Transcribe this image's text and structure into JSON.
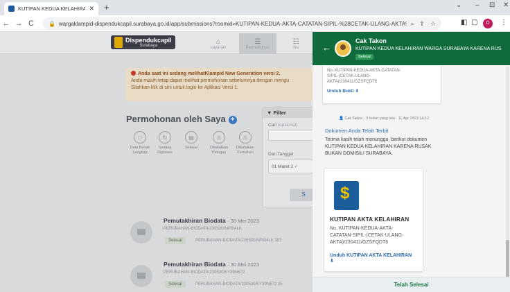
{
  "browser": {
    "tab_title": "KUTIPAN KEDUA KELAHIRAN WA",
    "new_tab": "+",
    "url": "wargaklampid-dispendukcapil.surabaya.go.id/app/submissions?roomid=KUTIPAN-KEDUA-AKTA-CATATAN-SIPIL-%28CETAK-ULANG-AKTA%29%2F230411%2FGZSF...",
    "profile_letter": "D",
    "minimize": "⌄",
    "restore": "–",
    "ext": "⊡",
    "close": "✕"
  },
  "app": {
    "logo_title": "Dispendukcapil",
    "logo_sub": "Surabaya",
    "menu": [
      {
        "label": "Layanan",
        "icon": "⌂"
      },
      {
        "label": "Permohonan",
        "icon": "☰"
      },
      {
        "label": "No",
        "icon": "☷"
      }
    ],
    "alert_line1": "Anda saat ini sedang melihatKlampid New Generation versi 2.",
    "alert_line2": "Anda masih tetap dapat melihat permohonan sebelumnya dengan mengu",
    "alert_line3": "Silahkan klik di sini untuk login ke Aplikasi Versi 1.",
    "section_title": "Permohonan oleh Saya",
    "statuses": [
      {
        "l1": "Data Belum",
        "l2": "Lengkap",
        "icon": "□"
      },
      {
        "l1": "Sedang",
        "l2": "Diproses",
        "icon": "↻"
      },
      {
        "l1": "Selesai",
        "l2": "",
        "icon": "▤"
      },
      {
        "l1": "Dibatalkan",
        "l2": "Petugas",
        "icon": "⚠"
      },
      {
        "l1": "Dibatalkan",
        "l2": "Pemohon",
        "icon": "⚠"
      }
    ],
    "filter_title": "Filter",
    "filter_cari_label": "Cari",
    "filter_cari_hint": "(opsional)",
    "filter_date_label": "Dari Tanggal",
    "filter_date_value": "01 Maret 2",
    "filter_btn": "S",
    "submissions": [
      {
        "title": "Pemutakhiran Biodata",
        "date": "· 30 Mei 2023",
        "code": "PERUBAHAN-BIODATA/230530/MP8I4LK",
        "badge": "Selesai",
        "code2": "PERUBAHAN-BIODATA/230530/MP8I4LK 357"
      },
      {
        "title": "Pemutakhiran Biodata",
        "date": "· 30 Mei 2023",
        "code": "PERUBAHAN-BIODATA/230530/KY39N672",
        "badge": "Selesai",
        "code2": "PERUBAHAN-BIODATA/230530/KY39N672 35"
      }
    ]
  },
  "panel": {
    "name": "Cak Takon",
    "subject": "KUTIPAN KEDUA KELAHIRAN WARGA SURABAYA KARENA RUS",
    "badge": "Selesai",
    "prev_doc_l1": "No. KUTIPAN-KEDUA-AKTA-CATATAN-",
    "prev_doc_l2": "SIPIL-(CETAK-ULANG-",
    "prev_doc_l3": "AKTA)/230411/GZSFQDT6",
    "prev_download": "Unduh Bukti",
    "meta": "Cak Takon · 3 bulan yang lalu · 11 Apr 2023 14:12",
    "msg_title": "Dokumen Anda Telah Terbit",
    "msg_body": "Terima kasih telah menunggu, berikut dokumen KUTIPAN KEDUA KELAHIRAN KARENA RUSAK BUKAN DOMISILI SURABAYA.",
    "doc_title": "KUTIPAN AKTA KELAHIRAN",
    "doc_l1": "No. KUTIPAN-KEDUA-AKTA-",
    "doc_l2": "CATATAN-SIPIL-(CETAK-ULANG-",
    "doc_l3": "AKTA)/230411/GZSFQDT6",
    "doc_download": "Unduh KUTIPAN AKTA KELAHIRAN",
    "download_icon": "⬇",
    "footer": "Telah Selesai"
  }
}
